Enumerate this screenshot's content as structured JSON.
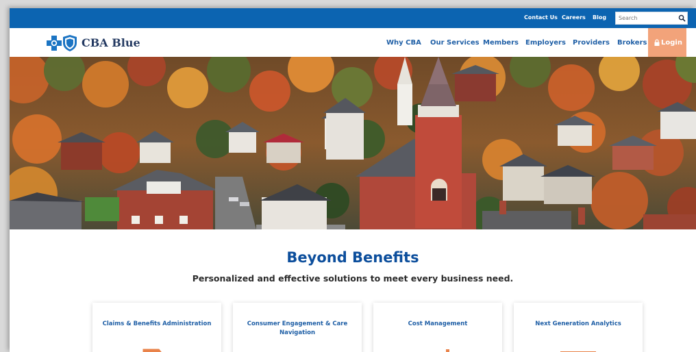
{
  "utility_nav": {
    "links": [
      "Contact Us",
      "Careers",
      "Blog"
    ],
    "search": {
      "placeholder": "Search",
      "value": ""
    }
  },
  "brand": {
    "name": "CBA Blue"
  },
  "main_nav": {
    "items": [
      "Why CBA",
      "Our Services",
      "Members",
      "Employers",
      "Providers",
      "Brokers"
    ],
    "login_label": "Login"
  },
  "section": {
    "title": "Beyond Benefits",
    "subtitle": "Personalized and effective solutions to meet every business need."
  },
  "cards": [
    {
      "title": "Claims & Benefits Administration",
      "icon": "arrow-icon"
    },
    {
      "title": "Consumer Engagement & Care Navigation",
      "icon": "navigation-icon"
    },
    {
      "title": "Cost Management",
      "icon": "chart-icon"
    },
    {
      "title": "Next Generation Analytics",
      "icon": "analytics-icon"
    }
  ],
  "colors": {
    "utility_bar": "#0c64b1",
    "nav_link": "#1f5fa6",
    "login_button": "#f2a37a",
    "section_title": "#0c4e9c",
    "card_icon": "#e9834a"
  }
}
